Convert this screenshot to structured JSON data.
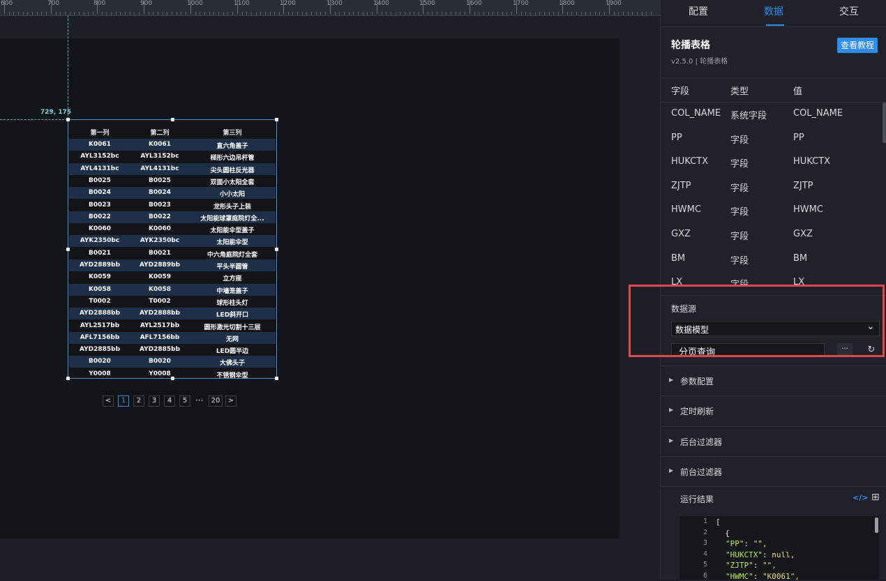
{
  "ruler": {
    "labels": [
      "600",
      "700",
      "800",
      "900",
      "1000",
      "1100",
      "1200",
      "1300",
      "1400",
      "1500",
      "1600",
      "1700",
      "1800",
      "1900"
    ]
  },
  "canvas": {
    "coord_label": "729, 175"
  },
  "carousel_table": {
    "headers": [
      "第一列",
      "第二列",
      "第三列"
    ],
    "rows": [
      [
        "K0061",
        "K0061",
        "直六角盖子"
      ],
      [
        "AYL3152bc",
        "AYL3152bc",
        "梯形六边吊杆管"
      ],
      [
        "AYL4131bc",
        "AYL4131bc",
        "尖头圆柱反光器"
      ],
      [
        "B0025",
        "B0025",
        "双面小太阳全套"
      ],
      [
        "B0024",
        "B0024",
        "小小太阳"
      ],
      [
        "B0023",
        "B0023",
        "龙形头子上装"
      ],
      [
        "B0022",
        "B0022",
        "太阳能球罩庭院灯全..."
      ],
      [
        "K0060",
        "K0060",
        "太阳能伞型盖子"
      ],
      [
        "AYK2350bc",
        "AYK2350bc",
        "太阳能伞型"
      ],
      [
        "B0021",
        "B0021",
        "中六角庭院灯全套"
      ],
      [
        "AYD2889bb",
        "AYD2889bb",
        "平头半圆管"
      ],
      [
        "K0059",
        "K0059",
        "立方座"
      ],
      [
        "K0058",
        "K0058",
        "中墙笼盖子"
      ],
      [
        "T0002",
        "T0002",
        "球形柱头灯"
      ],
      [
        "AYD2888bb",
        "AYD2888bb",
        "LED斜开口"
      ],
      [
        "AYL2517bb",
        "AYL2517bb",
        "圆形激光切割十三层"
      ],
      [
        "AFL7156bb",
        "AFL7156bb",
        "无网"
      ],
      [
        "AYD2885bb",
        "AYD2885bb",
        "LED圆半边"
      ],
      [
        "B0020",
        "B0020",
        "大佛头子"
      ],
      [
        "Y0008",
        "Y0008",
        "不锈钢伞型"
      ]
    ]
  },
  "pagination": {
    "prev": "<",
    "pages": [
      "1",
      "2",
      "3",
      "4",
      "5"
    ],
    "ellipsis": "···",
    "last": "20",
    "next": ">",
    "current": "1"
  },
  "panel": {
    "tabs": [
      "配置",
      "数据",
      "交互"
    ],
    "active_tab": "数据",
    "component_title": "轮播表格",
    "component_subtitle": "v2.5.0 | 轮播表格",
    "tutorial_button": "查看教程",
    "field_headers": [
      "字段",
      "类型",
      "值"
    ],
    "fields": [
      [
        "COL_NAME",
        "系统字段",
        "COL_NAME"
      ],
      [
        "PP",
        "字段",
        "PP"
      ],
      [
        "HUKCTX",
        "字段",
        "HUKCTX"
      ],
      [
        "ZJTP",
        "字段",
        "ZJTP"
      ],
      [
        "HWMC",
        "字段",
        "HWMC"
      ],
      [
        "GXZ",
        "字段",
        "GXZ"
      ],
      [
        "BM",
        "字段",
        "BM"
      ],
      [
        "LX",
        "字段",
        "LX"
      ]
    ],
    "datasource_label": "数据源",
    "datasource_select": "数据模型",
    "query_input": "分页查询",
    "more_icon": "···",
    "sections": [
      "参数配置",
      "定时刷新",
      "后台过滤器",
      "前台过滤器"
    ],
    "result_label": "运行结果",
    "code_lines": [
      {
        "n": "1",
        "text": "["
      },
      {
        "n": "2",
        "text": "  {"
      },
      {
        "n": "3",
        "key": "\"PP\"",
        "val": "\"\","
      },
      {
        "n": "4",
        "key": "\"HUKCTX\"",
        "val": "null,"
      },
      {
        "n": "5",
        "key": "\"ZJTP\"",
        "val": "\"\","
      },
      {
        "n": "6",
        "key": "\"HWMC\"",
        "val": "\"K0061\","
      }
    ]
  },
  "colors": {
    "accent": "#2f8cf0",
    "highlight_box": "#e0484b",
    "row_alt": "#1e3048"
  }
}
